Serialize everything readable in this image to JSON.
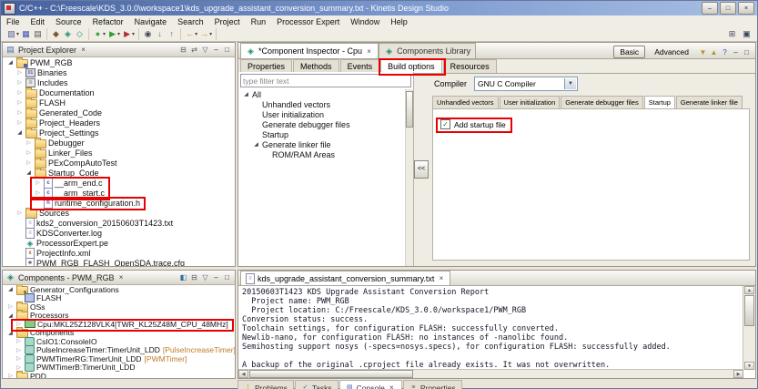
{
  "colors": {
    "annotation": "#e60000",
    "suffix_orange": "#c07a28",
    "titlebar_blue": "#44619e"
  },
  "titlebar": {
    "title": "C/C++ - C:\\Freescale\\KDS_3.0.0\\workspace1\\kds_upgrade_assistant_conversion_summary.txt - Kinetis Design Studio",
    "window_controls": [
      "minimize",
      "maximize",
      "close"
    ]
  },
  "menubar": [
    "File",
    "Edit",
    "Source",
    "Refactor",
    "Navigate",
    "Search",
    "Project",
    "Run",
    "Processor Expert",
    "Window",
    "Help"
  ],
  "toolbar": {
    "groups": [
      [
        {
          "name": "new-wizard",
          "dropdown": true
        },
        {
          "name": "save"
        },
        {
          "name": "print"
        }
      ],
      [
        {
          "name": "build"
        },
        {
          "name": "generate-processor-expert-code"
        },
        {
          "name": "new-component"
        }
      ],
      [
        {
          "name": "debug",
          "dropdown": true
        },
        {
          "name": "run",
          "dropdown": true
        },
        {
          "name": "external-tools",
          "dropdown": true
        }
      ],
      [
        {
          "name": "search"
        },
        {
          "name": "next-annotation"
        },
        {
          "name": "prev-annotation"
        }
      ],
      [
        {
          "name": "back",
          "dropdown": true
        },
        {
          "name": "forward",
          "dropdown": true
        }
      ]
    ],
    "perspective_bar": [
      {
        "name": "open-perspective"
      },
      {
        "name": "cpp-perspective"
      }
    ]
  },
  "project_explorer": {
    "title": "Project Explorer",
    "toolbar_icons": [
      "collapse-all",
      "link-with-editor",
      "view-menu",
      "minimize",
      "maximize"
    ],
    "tree": [
      {
        "label": "PWM_RGB",
        "depth": 0,
        "arrow": "open",
        "icon": "project"
      },
      {
        "label": "Binaries",
        "depth": 1,
        "arrow": "closed",
        "icon": "binaries"
      },
      {
        "label": "Includes",
        "depth": 1,
        "arrow": "closed",
        "icon": "includes"
      },
      {
        "label": "Documentation",
        "depth": 1,
        "arrow": "closed",
        "icon": "folder"
      },
      {
        "label": "FLASH",
        "depth": 1,
        "arrow": "closed",
        "icon": "folder"
      },
      {
        "label": "Generated_Code",
        "depth": 1,
        "arrow": "closed",
        "icon": "folder"
      },
      {
        "label": "Project_Headers",
        "depth": 1,
        "arrow": "closed",
        "icon": "folder"
      },
      {
        "label": "Project_Settings",
        "depth": 1,
        "arrow": "open",
        "icon": "folder"
      },
      {
        "label": "Debugger",
        "depth": 2,
        "arrow": "closed",
        "icon": "folder"
      },
      {
        "label": "Linker_Files",
        "depth": 2,
        "arrow": "closed",
        "icon": "folder"
      },
      {
        "label": "PExCompAutoTest",
        "depth": 2,
        "arrow": "closed",
        "icon": "folder"
      },
      {
        "label": "Startup_Code",
        "depth": 2,
        "arrow": "open",
        "icon": "folder"
      },
      {
        "label": "__arm_end.c",
        "depth": 3,
        "arrow": "closed",
        "icon": "cfile",
        "box": "startup-files"
      },
      {
        "label": "__arm_start.c",
        "depth": 3,
        "arrow": "closed",
        "icon": "cfile",
        "box": "startup-files"
      },
      {
        "label": "runtime_configuration.h",
        "depth": 3,
        "icon": "hfile",
        "box": "runtime-configuration"
      },
      {
        "label": "Sources",
        "depth": 1,
        "arrow": "closed",
        "icon": "folder"
      },
      {
        "label": "kds2_conversion_20150603T1423.txt",
        "depth": 1,
        "icon": "txtfile"
      },
      {
        "label": "KDSConverter.log",
        "depth": 1,
        "icon": "txtfile"
      },
      {
        "label": "ProcessorExpert.pe",
        "depth": 1,
        "icon": "pefile"
      },
      {
        "label": "ProjectInfo.xml",
        "depth": 1,
        "icon": "xmlfile"
      },
      {
        "label": "PWM_RGB_FLASH_OpenSDA.trace.cfg",
        "depth": 1,
        "icon": "cfgfile"
      }
    ]
  },
  "components_view": {
    "title": "Components - PWM_RGB",
    "toolbar_icons": [
      "show-categories",
      "collapse-all",
      "view-menu",
      "minimize",
      "maximize"
    ],
    "tree": [
      {
        "label": "Generator_Configurations",
        "depth": 0,
        "arrow": "open",
        "icon": "genconf"
      },
      {
        "label": "FLASH",
        "depth": 1,
        "icon": "flash"
      },
      {
        "label": "OSs",
        "depth": 0,
        "arrow": "closed",
        "icon": "folder"
      },
      {
        "label": "Processors",
        "depth": 0,
        "arrow": "open",
        "icon": "folder"
      },
      {
        "label": "Cpu:MKL25Z128VLK4[TWR_KL25Z48M_CPU_48MHz]",
        "depth": 1,
        "arrow": "closed",
        "icon": "cpu",
        "box": "cpu-component"
      },
      {
        "label": "Components",
        "depth": 0,
        "arrow": "open",
        "icon": "folder"
      },
      {
        "label": "CsIO1:ConsoleIO",
        "depth": 1,
        "arrow": "closed",
        "icon": "component"
      },
      {
        "label": "PulseIncreaseTimer:TimerUnit_LDD",
        "suffix": "[PulseIncreaseTimer]",
        "depth": 1,
        "arrow": "closed",
        "icon": "component"
      },
      {
        "label": "PWMTimerRG:TimerUnit_LDD",
        "suffix": "[PWMTimer]",
        "depth": 1,
        "arrow": "closed",
        "icon": "component"
      },
      {
        "label": "PWMTimerB:TimerUnit_LDD",
        "depth": 1,
        "arrow": "closed",
        "icon": "component"
      },
      {
        "label": "PDD",
        "depth": 0,
        "arrow": "closed",
        "icon": "folder"
      }
    ]
  },
  "inspector": {
    "tabs": [
      {
        "label": "*Component Inspector - Cpu",
        "active": true,
        "closable": true
      },
      {
        "label": "Components Library",
        "active": false
      }
    ],
    "view_buttons": [
      {
        "label": "Basic",
        "active": true
      },
      {
        "label": "Advanced",
        "active": false
      }
    ],
    "corner_icons": [
      "export-settings",
      "import-settings",
      "help",
      "minimize",
      "maximize"
    ],
    "subtabs": [
      {
        "label": "Properties"
      },
      {
        "label": "Methods"
      },
      {
        "label": "Events"
      },
      {
        "label": "Build options",
        "active": true,
        "box": "build-options-tab"
      },
      {
        "label": "Resources"
      }
    ],
    "filter_placeholder": "type filter text",
    "tree": [
      {
        "label": "All",
        "depth": 0,
        "arrow": "open"
      },
      {
        "label": "Unhandled vectors",
        "depth": 1
      },
      {
        "label": "User initialization",
        "depth": 1
      },
      {
        "label": "Generate debugger files",
        "depth": 1
      },
      {
        "label": "Startup",
        "depth": 1
      },
      {
        "label": "Generate linker file",
        "depth": 1,
        "arrow": "open"
      },
      {
        "label": "ROM/RAM Areas",
        "depth": 2
      }
    ],
    "collapse_label": "<<",
    "compiler": {
      "label": "Compiler",
      "value": "GNU C Compiler"
    },
    "option_tabs": [
      {
        "label": "Unhandled vectors"
      },
      {
        "label": "User initialization"
      },
      {
        "label": "Generate debugger files"
      },
      {
        "label": "Startup",
        "active": true
      },
      {
        "label": "Generate linker file"
      }
    ],
    "startup_option": {
      "label": "Add startup file",
      "checked": true,
      "box": "add-startup-file"
    }
  },
  "editor": {
    "tab": {
      "label": "kds_upgrade_assistant_conversion_summary.txt",
      "closable": true
    },
    "lines": [
      "20150603T1423 KDS Upgrade Assistant Conversion Report",
      "  Project name: PWM_RGB",
      "  Project location: C:/Freescale/KDS_3.0.0/workspace1/PWM_RGB",
      "Conversion status: success.",
      "Toolchain settings, for configuration FLASH: successfully converted.",
      "Newlib-nano, for configuration FLASH: no instances of -nanolibc found.",
      "Semihosting support nosys (-specs=nosys.specs), for configuration FLASH: successfully added.",
      "",
      "A backup of the original .cproject file already exists. It was not overwritten."
    ]
  },
  "bottom_tabs": [
    {
      "label": "Problems",
      "icon": "problems"
    },
    {
      "label": "Tasks",
      "icon": "tasks"
    },
    {
      "label": "Console",
      "icon": "console",
      "active": true,
      "closable": true
    },
    {
      "label": "Properties",
      "icon": "properties"
    }
  ]
}
